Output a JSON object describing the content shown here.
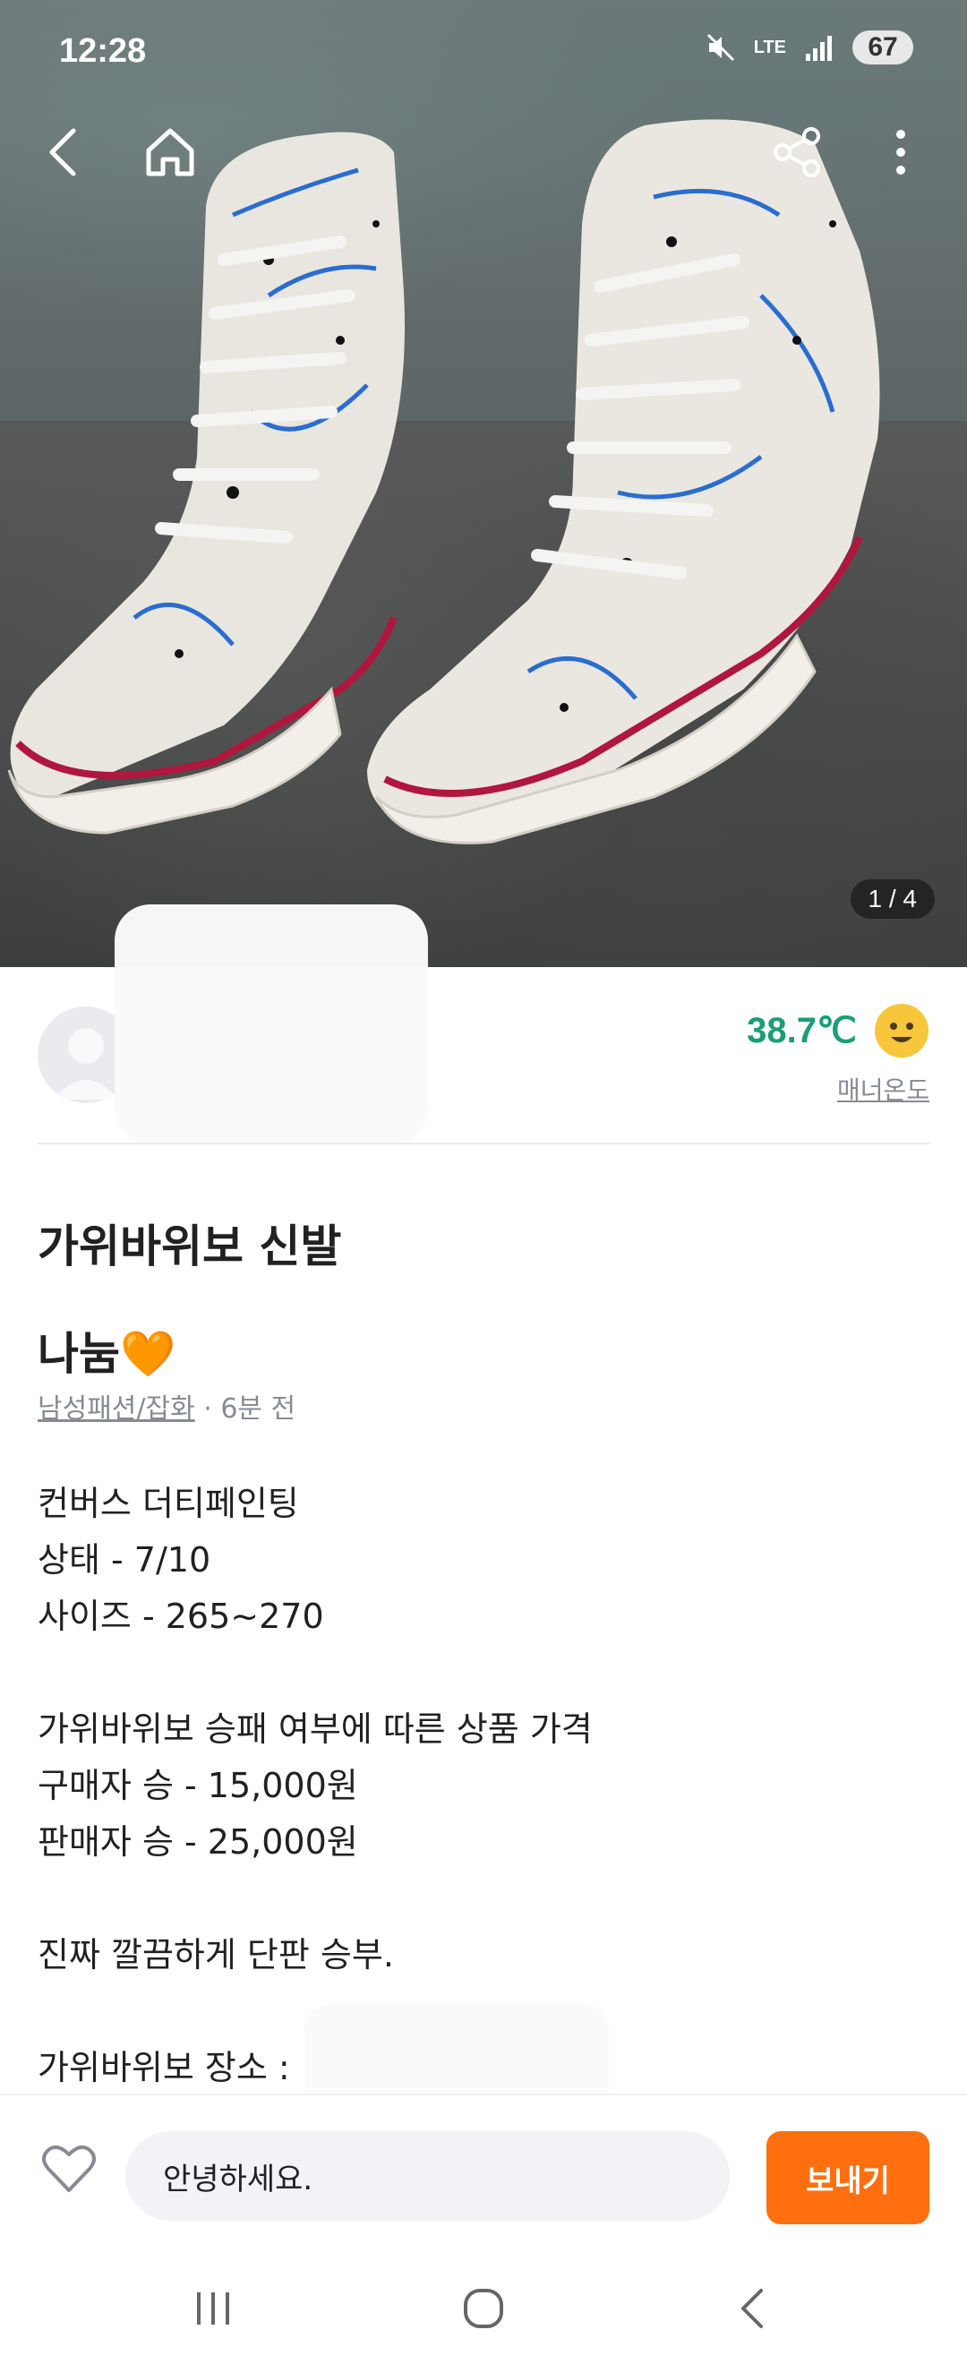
{
  "status_bar": {
    "time": "12:28",
    "network": "LTE",
    "battery": "67"
  },
  "hero": {
    "counter": "1 / 4"
  },
  "seller": {
    "temperature": "38.7℃",
    "manner_label": "매너온도"
  },
  "post": {
    "title_line1": "가위바위보 신발",
    "title_line2": "나눔🧡",
    "category": "남성패션/잡화",
    "time_ago": " · 6분 전",
    "description": "컨버스 더티페인팅\n상태 - 7/10\n사이즈 - 265~270\n\n가위바위보 승패 여부에 따른 상품 가격\n구매자 승 - 15,000원\n판매자 승 - 25,000원\n\n진짜 깔끔하게 단판 승부.\n\n가위바위보 장소 : "
  },
  "chat": {
    "input_value": "안녕하세요.",
    "send_label": "보내기"
  },
  "colors": {
    "accent": "#ff6f0f",
    "temperature": "#1a9e78"
  }
}
